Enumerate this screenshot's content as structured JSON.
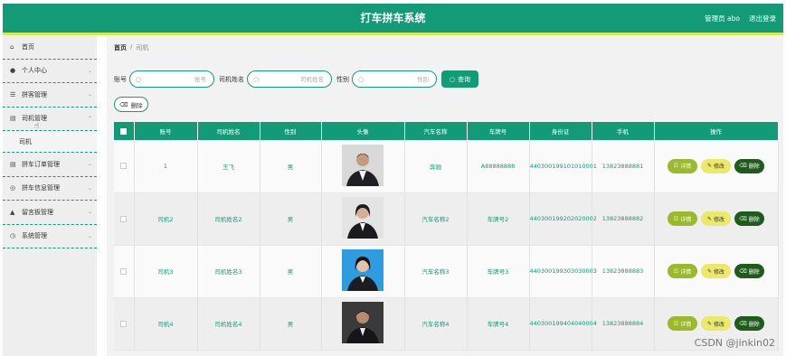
{
  "header": {
    "title": "打车拼车系统",
    "admin_label": "管理员 abo",
    "logout_label": "退出登录"
  },
  "sidebar": {
    "items": [
      {
        "label": "首页",
        "icon": "home-icon"
      },
      {
        "label": "个人中心",
        "icon": "user-icon"
      },
      {
        "label": "拼客管理",
        "icon": "list-icon"
      },
      {
        "label": "司机管理",
        "icon": "car-icon"
      },
      {
        "label": "拼车订单管理",
        "icon": "order-icon"
      },
      {
        "label": "拼车信息管理",
        "icon": "compass-icon"
      },
      {
        "label": "留言板管理",
        "icon": "message-icon"
      },
      {
        "label": "系统管理",
        "icon": "settings-icon"
      }
    ],
    "submenu": {
      "label": "司机"
    }
  },
  "breadcrumb": {
    "home": "首页",
    "separator": "/",
    "current": "司机"
  },
  "search": {
    "account_label": "账号",
    "account_placeholder": "账号",
    "name_label": "司机姓名",
    "name_placeholder": "司机姓名",
    "gender_label": "性别",
    "gender_placeholder": "性别",
    "query_label": "查询"
  },
  "toolbar": {
    "delete_label": "删除"
  },
  "table": {
    "headers": [
      "账号",
      "司机姓名",
      "性别",
      "头像",
      "汽车名称",
      "车牌号",
      "身份证",
      "手机",
      "操作"
    ],
    "rows": [
      {
        "account": "1",
        "name": "王飞",
        "gender": "男",
        "car": "奔驰",
        "plate": "A88888888",
        "id_card": "440300199101010001",
        "phone": "13823888881"
      },
      {
        "account": "司机2",
        "name": "司机姓名2",
        "gender": "男",
        "car": "汽车名称2",
        "plate": "车牌号2",
        "id_card": "440300199202020002",
        "phone": "13823888882"
      },
      {
        "account": "司机3",
        "name": "司机姓名3",
        "gender": "男",
        "car": "汽车名称3",
        "plate": "车牌号3",
        "id_card": "440300199303030003",
        "phone": "13823888883"
      },
      {
        "account": "司机4",
        "name": "司机姓名4",
        "gender": "男",
        "car": "汽车名称4",
        "plate": "车牌号4",
        "id_card": "440300199404040004",
        "phone": "13823888884"
      }
    ],
    "actions": {
      "detail": "详情",
      "edit": "修改",
      "delete": "删除"
    }
  },
  "watermark": "CSDN @jinkin02",
  "colors": {
    "primary": "#139a77",
    "accent_line": "#d8e94a",
    "detail": "#9ab92c",
    "edit": "#ece86a",
    "delete": "#1f5b1a"
  }
}
